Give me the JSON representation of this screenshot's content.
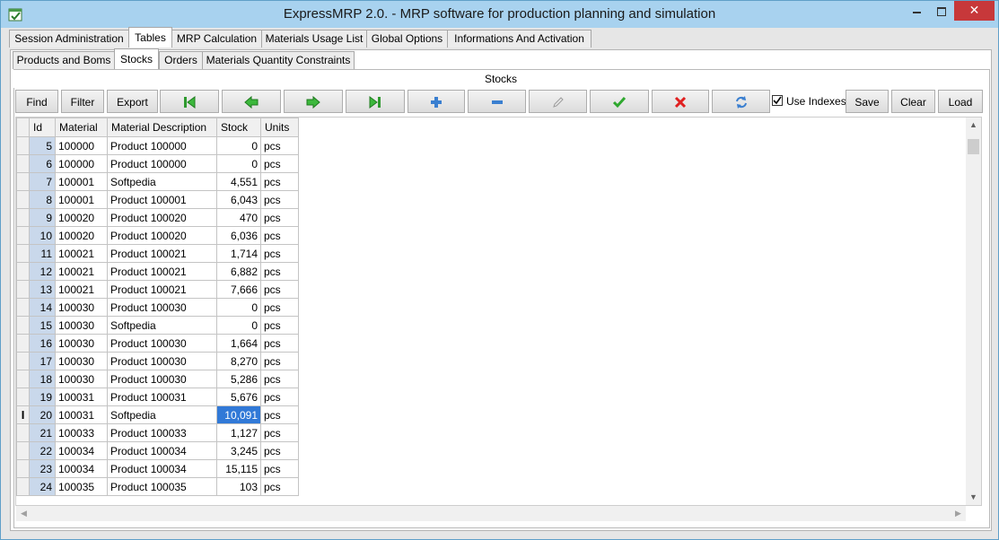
{
  "window": {
    "title": "ExpressMRP 2.0. - MRP software for production planning and simulation"
  },
  "main_tabs": [
    {
      "label": "Session Administration"
    },
    {
      "label": "Tables"
    },
    {
      "label": "MRP Calculation"
    },
    {
      "label": "Materials Usage List"
    },
    {
      "label": "Global Options"
    },
    {
      "label": "Informations And Activation"
    }
  ],
  "sub_tabs": [
    {
      "label": "Products and Boms"
    },
    {
      "label": "Stocks"
    },
    {
      "label": "Orders"
    },
    {
      "label": "Materials Quantity Constraints"
    }
  ],
  "panel": {
    "title": "Stocks"
  },
  "toolbar": {
    "find": "Find",
    "filter": "Filter",
    "export": "Export",
    "use_indexes": "Use Indexes",
    "use_indexes_checked": true,
    "save": "Save",
    "clear": "Clear",
    "load": "Load",
    "icons": [
      "first-record-icon",
      "previous-record-icon",
      "next-record-icon",
      "last-record-icon",
      "add-icon",
      "remove-icon",
      "edit-icon",
      "confirm-icon",
      "cancel-icon",
      "refresh-icon"
    ]
  },
  "grid": {
    "columns": [
      "Id",
      "Material",
      "Material Description",
      "Stock",
      "Units"
    ],
    "rows": [
      {
        "id": "5",
        "material": "100000",
        "desc": "Product 100000",
        "stock": "0",
        "units": "pcs"
      },
      {
        "id": "6",
        "material": "100000",
        "desc": "Product 100000",
        "stock": "0",
        "units": "pcs"
      },
      {
        "id": "7",
        "material": "100001",
        "desc": "Softpedia",
        "stock": "4,551",
        "units": "pcs"
      },
      {
        "id": "8",
        "material": "100001",
        "desc": "Product 100001",
        "stock": "6,043",
        "units": "pcs"
      },
      {
        "id": "9",
        "material": "100020",
        "desc": "Product 100020",
        "stock": "470",
        "units": "pcs"
      },
      {
        "id": "10",
        "material": "100020",
        "desc": "Product 100020",
        "stock": "6,036",
        "units": "pcs"
      },
      {
        "id": "11",
        "material": "100021",
        "desc": "Product 100021",
        "stock": "1,714",
        "units": "pcs"
      },
      {
        "id": "12",
        "material": "100021",
        "desc": "Product 100021",
        "stock": "6,882",
        "units": "pcs"
      },
      {
        "id": "13",
        "material": "100021",
        "desc": "Product 100021",
        "stock": "7,666",
        "units": "pcs"
      },
      {
        "id": "14",
        "material": "100030",
        "desc": "Product 100030",
        "stock": "0",
        "units": "pcs"
      },
      {
        "id": "15",
        "material": "100030",
        "desc": "Softpedia",
        "stock": "0",
        "units": "pcs"
      },
      {
        "id": "16",
        "material": "100030",
        "desc": "Product 100030",
        "stock": "1,664",
        "units": "pcs"
      },
      {
        "id": "17",
        "material": "100030",
        "desc": "Product 100030",
        "stock": "8,270",
        "units": "pcs"
      },
      {
        "id": "18",
        "material": "100030",
        "desc": "Product 100030",
        "stock": "5,286",
        "units": "pcs"
      },
      {
        "id": "19",
        "material": "100031",
        "desc": "Product 100031",
        "stock": "5,676",
        "units": "pcs"
      },
      {
        "id": "20",
        "material": "100031",
        "desc": "Softpedia",
        "stock": "10,091",
        "units": "pcs",
        "selected": true,
        "editing": true
      },
      {
        "id": "21",
        "material": "100033",
        "desc": "Product 100033",
        "stock": "1,127",
        "units": "pcs"
      },
      {
        "id": "22",
        "material": "100034",
        "desc": "Product 100034",
        "stock": "3,245",
        "units": "pcs"
      },
      {
        "id": "23",
        "material": "100034",
        "desc": "Product 100034",
        "stock": "15,115",
        "units": "pcs"
      },
      {
        "id": "24",
        "material": "100035",
        "desc": "Product 100035",
        "stock": "103",
        "units": "pcs"
      }
    ]
  }
}
